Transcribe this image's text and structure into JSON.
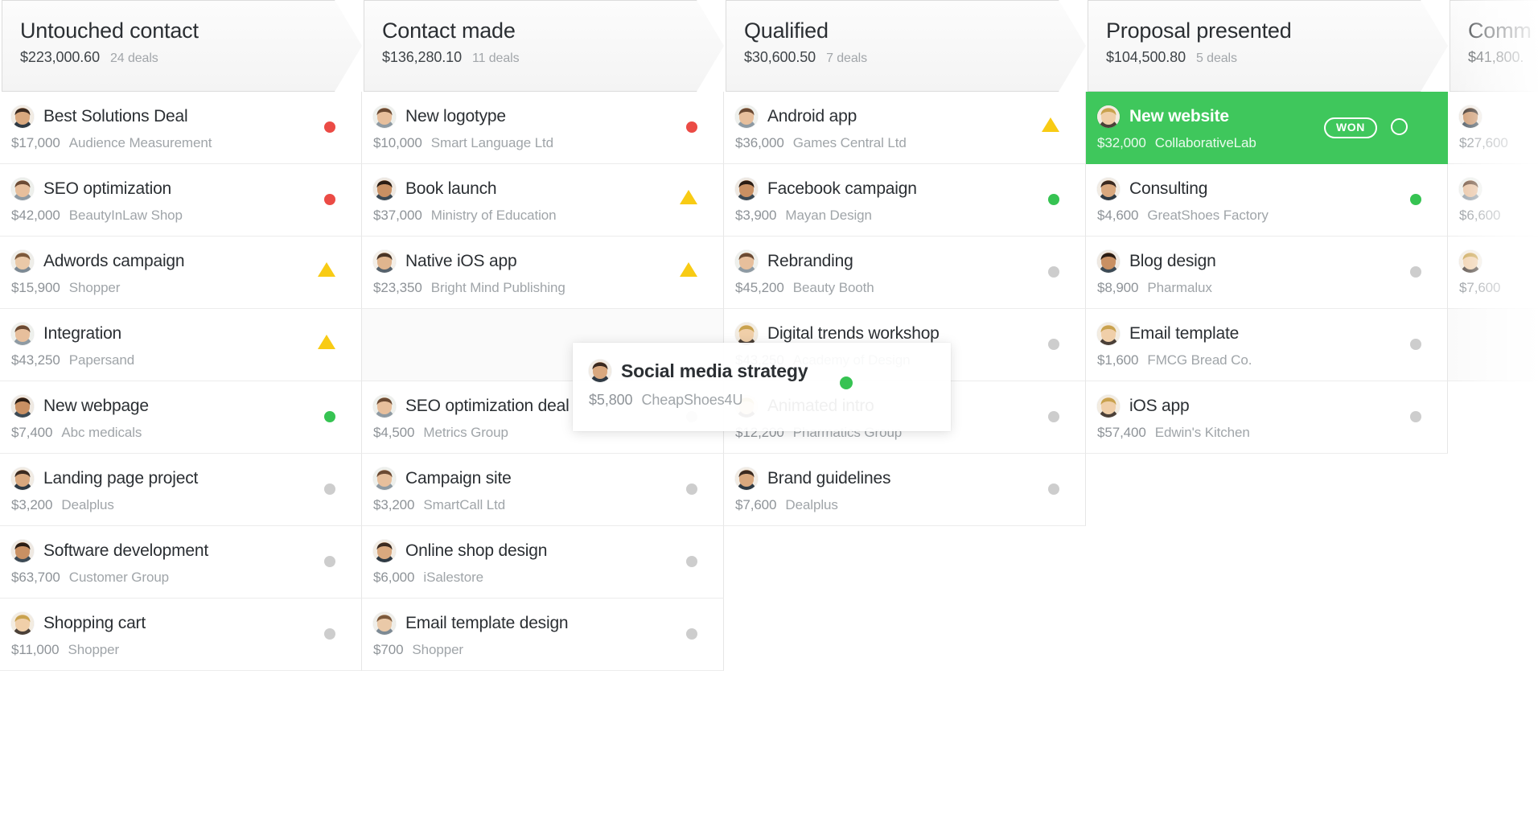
{
  "board": {
    "type": "crm-pipeline-kanban",
    "colors": {
      "won": "#3fc75c",
      "status_hot": "#eb4b45",
      "status_warm": "#f8cb14",
      "status_good": "#36c352",
      "status_idle": "#cdcdcd",
      "header_bg": "#f4f4f4",
      "text_primary": "#2b2f33",
      "text_muted": "#a0a5a9"
    }
  },
  "stages": [
    {
      "name": "Untouched contact",
      "amount": "$223,000.60",
      "deals": "24 deals",
      "cards": [
        {
          "title": "Best Solutions Deal",
          "amount": "$17,000",
          "org": "Audience Measurement",
          "status": "red",
          "avatar": "m1"
        },
        {
          "title": "SEO optimization",
          "amount": "$42,000",
          "org": "BeautyInLaw Shop",
          "status": "red",
          "avatar": "f1"
        },
        {
          "title": "Adwords campaign",
          "amount": "$15,900",
          "org": "Shopper",
          "status": "tri",
          "avatar": "f2"
        },
        {
          "title": "Integration",
          "amount": "$43,250",
          "org": "Papersand",
          "status": "tri",
          "avatar": "f1"
        },
        {
          "title": "New webpage",
          "amount": "$7,400",
          "org": "Abc medicals",
          "status": "green",
          "avatar": "m2"
        },
        {
          "title": "Landing page project",
          "amount": "$3,200",
          "org": "Dealplus",
          "status": "grey",
          "avatar": "m1"
        },
        {
          "title": "Software development",
          "amount": "$63,700",
          "org": "Customer Group",
          "status": "grey",
          "avatar": "m2"
        },
        {
          "title": "Shopping cart",
          "amount": "$11,000",
          "org": "Shopper",
          "status": "grey",
          "avatar": "f3"
        }
      ]
    },
    {
      "name": "Contact made",
      "amount": "$136,280.10",
      "deals": "11 deals",
      "cards": [
        {
          "title": "New logotype",
          "amount": "$10,000",
          "org": "Smart Language Ltd",
          "status": "red",
          "avatar": "f1"
        },
        {
          "title": "Book launch",
          "amount": "$37,000",
          "org": "Ministry of Education",
          "status": "tri",
          "avatar": "m2"
        },
        {
          "title": "Native iOS app",
          "amount": "$23,350",
          "org": "Bright Mind Publishing",
          "status": "tri",
          "avatar": "m3"
        },
        {
          "title": "",
          "amount": "",
          "org": "",
          "status": "none",
          "avatar": "none"
        },
        {
          "title": "SEO optimization deal",
          "amount": "$4,500",
          "org": "Metrics Group",
          "status": "grey",
          "avatar": "f1"
        },
        {
          "title": "Campaign site",
          "amount": "$3,200",
          "org": "SmartCall Ltd",
          "status": "grey",
          "avatar": "f1"
        },
        {
          "title": "Online shop design",
          "amount": "$6,000",
          "org": "iSalestore",
          "status": "grey",
          "avatar": "m1"
        },
        {
          "title": "Email template design",
          "amount": "$700",
          "org": "Shopper",
          "status": "grey",
          "avatar": "f2"
        }
      ]
    },
    {
      "name": "Qualified",
      "amount": "$30,600.50",
      "deals": "7 deals",
      "cards": [
        {
          "title": "Android app",
          "amount": "$36,000",
          "org": "Games Central Ltd",
          "status": "tri",
          "avatar": "f1"
        },
        {
          "title": "Facebook campaign",
          "amount": "$3,900",
          "org": "Mayan Design",
          "status": "green",
          "avatar": "m2"
        },
        {
          "title": "Rebranding",
          "amount": "$45,200",
          "org": "Beauty Booth",
          "status": "grey",
          "avatar": "f1"
        },
        {
          "title": "Digital trends workshop",
          "amount": "$43,250",
          "org": "Academy of Design",
          "status": "grey",
          "avatar": "f3"
        },
        {
          "title": "Animated intro",
          "amount": "$12,200",
          "org": "Pharmatics Group",
          "status": "grey",
          "avatar": "f3"
        },
        {
          "title": "Brand guidelines",
          "amount": "$7,600",
          "org": "Dealplus",
          "status": "grey",
          "avatar": "m1"
        }
      ]
    },
    {
      "name": "Proposal presented",
      "amount": "$104,500.80",
      "deals": "5 deals",
      "cards": [
        {
          "title": "New website",
          "amount": "$32,000",
          "org": "CollaborativeLab",
          "status": "won",
          "avatar": "f3",
          "badge": "WON"
        },
        {
          "title": "Consulting",
          "amount": "$4,600",
          "org": "GreatShoes Factory",
          "status": "green",
          "avatar": "m1"
        },
        {
          "title": "Blog design",
          "amount": "$8,900",
          "org": "Pharmalux",
          "status": "grey",
          "avatar": "m2"
        },
        {
          "title": "Email template",
          "amount": "$1,600",
          "org": "FMCG Bread Co.",
          "status": "grey",
          "avatar": "f3"
        },
        {
          "title": "iOS app",
          "amount": "$57,400",
          "org": "Edwin's Kitchen",
          "status": "grey",
          "avatar": "f3"
        }
      ]
    },
    {
      "name": "Comm",
      "amount": "$41,800.",
      "deals": "",
      "cards": [
        {
          "title": "",
          "amount": "$27,600",
          "org": "",
          "status": "none",
          "avatar": "m2"
        },
        {
          "title": "",
          "amount": "$6,600",
          "org": "",
          "status": "none",
          "avatar": "f1"
        },
        {
          "title": "",
          "amount": "$7,600",
          "org": "",
          "status": "none",
          "avatar": "f3"
        },
        {
          "title": "",
          "amount": "",
          "org": "",
          "status": "none",
          "avatar": "none"
        }
      ]
    }
  ],
  "drag_card": {
    "title": "Social media strategy",
    "amount": "$5,800",
    "org": "CheapShoes4U",
    "status": "green",
    "avatar": "m1"
  }
}
